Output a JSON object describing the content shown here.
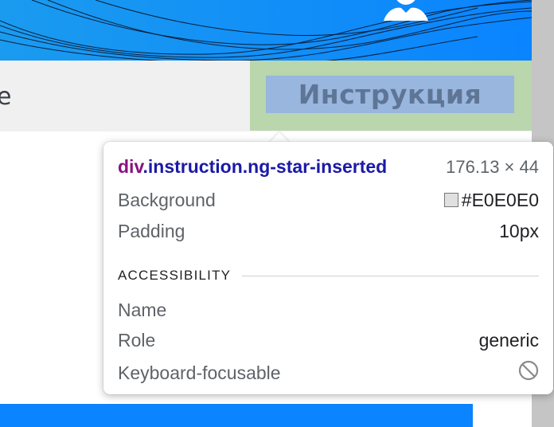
{
  "page": {
    "edge_text": "e",
    "instruction_label": "Инструкция"
  },
  "colors": {
    "banner_blue": "#0a84ff",
    "padding_overlay": "#b9d6ac",
    "content_overlay": "#98b6de",
    "header_bg": "#f0f0f0"
  },
  "tooltip": {
    "selector_tag": "div",
    "selector_classes": ".instruction.ng-star-inserted",
    "dimensions": "176.13 × 44",
    "background_label": "Background",
    "background_value": "#E0E0E0",
    "padding_label": "Padding",
    "padding_value": "10px",
    "accessibility_title": "ACCESSIBILITY",
    "name_label": "Name",
    "name_value": "",
    "role_label": "Role",
    "role_value": "generic",
    "keyboard_label": "Keyboard-focusable",
    "keyboard_icon": "not-allowed-icon"
  }
}
